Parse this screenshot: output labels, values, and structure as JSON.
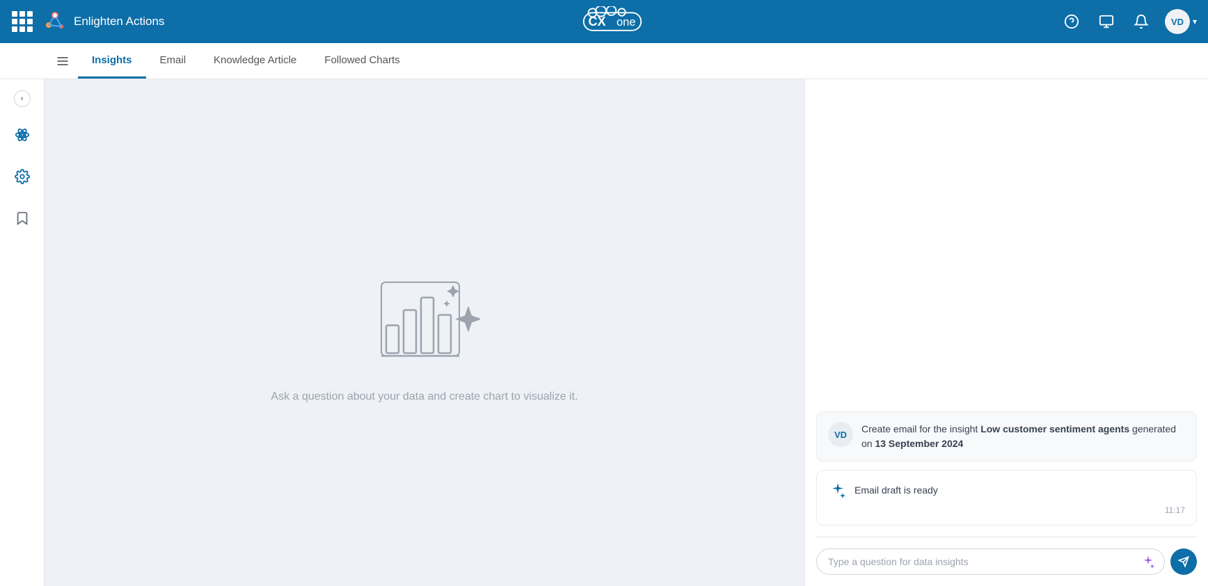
{
  "app": {
    "brand_name": "Enlighten Actions",
    "logo_text": "CXone",
    "user_initials": "VD"
  },
  "top_nav": {
    "help_icon": "help-circle-icon",
    "monitor_icon": "monitor-icon",
    "bell_icon": "bell-icon",
    "chevron_icon": "chevron-down-icon"
  },
  "tabs": [
    {
      "id": "insights",
      "label": "Insights",
      "active": true
    },
    {
      "id": "email",
      "label": "Email",
      "active": false
    },
    {
      "id": "knowledge-article",
      "label": "Knowledge Article",
      "active": false
    },
    {
      "id": "followed-charts",
      "label": "Followed Charts",
      "active": false
    }
  ],
  "sidebar": {
    "collapse_label": "›",
    "atom_icon": "atom-icon",
    "settings_icon": "settings-icon",
    "bookmark_icon": "bookmark-icon"
  },
  "chart_panel": {
    "empty_text": "Ask a question about your data and create chart to visualize it."
  },
  "chat": {
    "message1": {
      "avatar": "VD",
      "text_prefix": "Create email for the insight ",
      "bold1": "Low customer sentiment agents",
      "text_middle": " generated on ",
      "bold2": "13 September 2024"
    },
    "message2": {
      "text": "Email draft is ready",
      "timestamp": "11:17"
    },
    "input_placeholder": "Type a question for data insights"
  }
}
